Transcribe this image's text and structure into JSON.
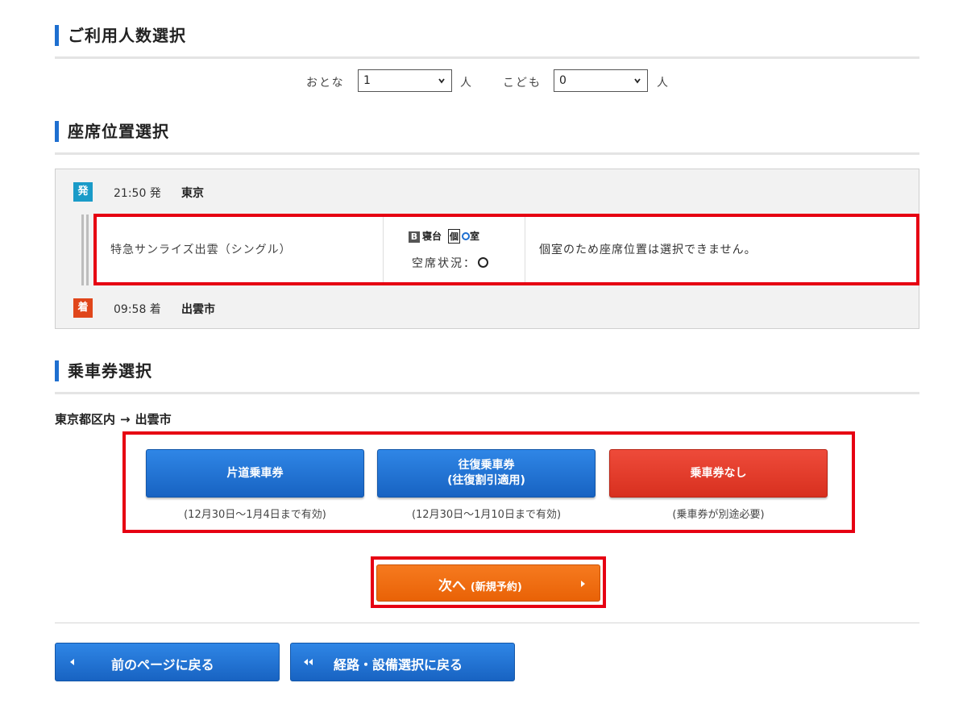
{
  "sections": {
    "people": "ご利用人数選択",
    "seat": "座席位置選択",
    "ticket": "乗車券選択"
  },
  "people": {
    "adult_label": "おとな",
    "adult_value": "1",
    "child_label": "こども",
    "child_value": "0",
    "unit": "人"
  },
  "seat": {
    "departure": {
      "badge": "発",
      "time": "21:50 発",
      "station": "東京"
    },
    "train": {
      "name": "特急サンライズ出雲（シングル）",
      "facility_b": "B",
      "facility_type": "寝台",
      "facility_room": "個",
      "facility_room_type": "室",
      "vacancy_label": "空席状況：",
      "note": "個室のため座席位置は選択できません。"
    },
    "arrival": {
      "badge": "着",
      "time": "09:58 着",
      "station": "出雲市"
    }
  },
  "ticket": {
    "route_from": "東京都区内",
    "route_arrow": "→",
    "route_to": "出雲市",
    "options": [
      {
        "line1": "片道乗車券",
        "line2": "",
        "note": "(12月30日～1月4日まで有効)"
      },
      {
        "line1": "往復乗車券",
        "line2": "(往復割引適用)",
        "note": "(12月30日～1月10日まで有効)"
      },
      {
        "line1": "乗車券なし",
        "line2": "",
        "note": "(乗車券が別途必要)"
      }
    ]
  },
  "next": {
    "label": "次へ",
    "sub": "(新規予約)"
  },
  "back": {
    "prev_page": "前のページに戻る",
    "route_select": "経路・設備選択に戻る"
  },
  "colors": {
    "accent_blue": "#1e6fd0",
    "highlight_red": "#e60012",
    "next_orange": "#f06d10",
    "no_ticket_red": "#e23b2a"
  }
}
